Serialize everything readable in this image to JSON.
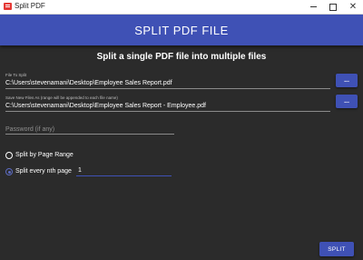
{
  "window": {
    "title": "Split PDF"
  },
  "header": {
    "title": "SPLIT PDF FILE"
  },
  "subtitle": "Split a single PDF file into multiple files",
  "file_to_split": {
    "label": "File To Split",
    "value": "C:\\Users\\stevenamani\\Desktop\\Employee Sales Report.pdf",
    "browse_label": "..."
  },
  "save_as": {
    "label": "Save New Files As (range will be appended to each file name)",
    "value": "C:\\Users\\stevenamani\\Desktop\\Employee Sales Report - Employee.pdf",
    "browse_label": "..."
  },
  "password": {
    "placeholder": "Password (if any)"
  },
  "options": {
    "page_range_label": "Split by Page Range",
    "nth_page_label": "Split every nth page",
    "selected": "nth_page",
    "nth_value": "1"
  },
  "split_button": "SPLIT",
  "colors": {
    "accent": "#3f51b5",
    "background": "#2b2b2b"
  }
}
